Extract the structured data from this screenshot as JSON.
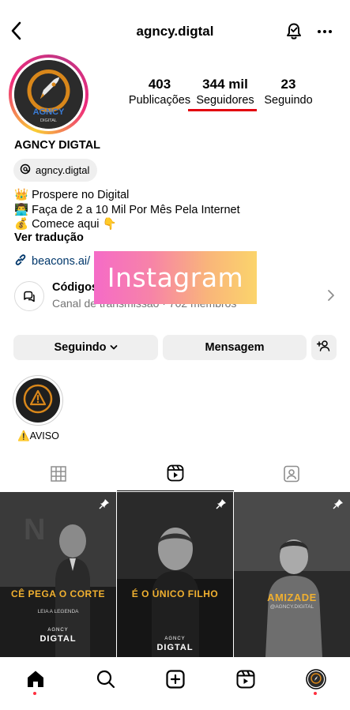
{
  "header": {
    "username": "agncy.digtal",
    "back_icon": "chevron-left-icon",
    "bell_icon": "notification-bell-icon",
    "more_icon": "more-options-icon"
  },
  "profile": {
    "avatar_brand": "AGNCY",
    "avatar_sub": "DIGITAL",
    "stats": [
      {
        "value": "403",
        "label": "Publicações"
      },
      {
        "value": "344 mil",
        "label": "Seguidores"
      },
      {
        "value": "23",
        "label": "Seguindo"
      }
    ],
    "display_name": "AGNCY DIGTAL",
    "threads_handle": "agncy.digtal",
    "bio": [
      "👑 Prospere no Digital",
      "👨‍💻 Faça de 2 a 10 Mil Por Mês Pela Internet",
      "💰 Comece aqui 👇"
    ],
    "translate": "Ver tradução",
    "link": "beacons.ai/"
  },
  "channel": {
    "title": "Códigos",
    "subtitle": "Canal de transmissão · 702 membros"
  },
  "overlay": {
    "label": "Instagram"
  },
  "actions": {
    "follow": "Seguindo",
    "message": "Mensagem"
  },
  "highlights": [
    {
      "label": "⚠️AVISO"
    }
  ],
  "tabs": [
    {
      "name": "grid"
    },
    {
      "name": "reels",
      "active": true
    },
    {
      "name": "tagged"
    }
  ],
  "posts": [
    {
      "caption": "CÊ PEGA O CORTE",
      "sub": "LEIA A LEGENDA",
      "brand_top": "AGNCY",
      "brand": "DIGTAL",
      "pinned": true
    },
    {
      "caption": "É O ÚNICO FILHO",
      "brand_top": "AGNCY",
      "brand": "DIGTAL",
      "pinned": true
    },
    {
      "caption": "AMIZADE",
      "sub": "@AGNCY.DIGITAL",
      "pinned": true
    }
  ],
  "colors": {
    "accent_underline": "#e3000f",
    "link": "#00376b",
    "caption_gold": "#f0b030",
    "notification_dot": "#ff3040"
  },
  "bottom_nav": [
    "home-icon",
    "search-icon",
    "create-icon",
    "reels-icon",
    "profile-avatar"
  ]
}
